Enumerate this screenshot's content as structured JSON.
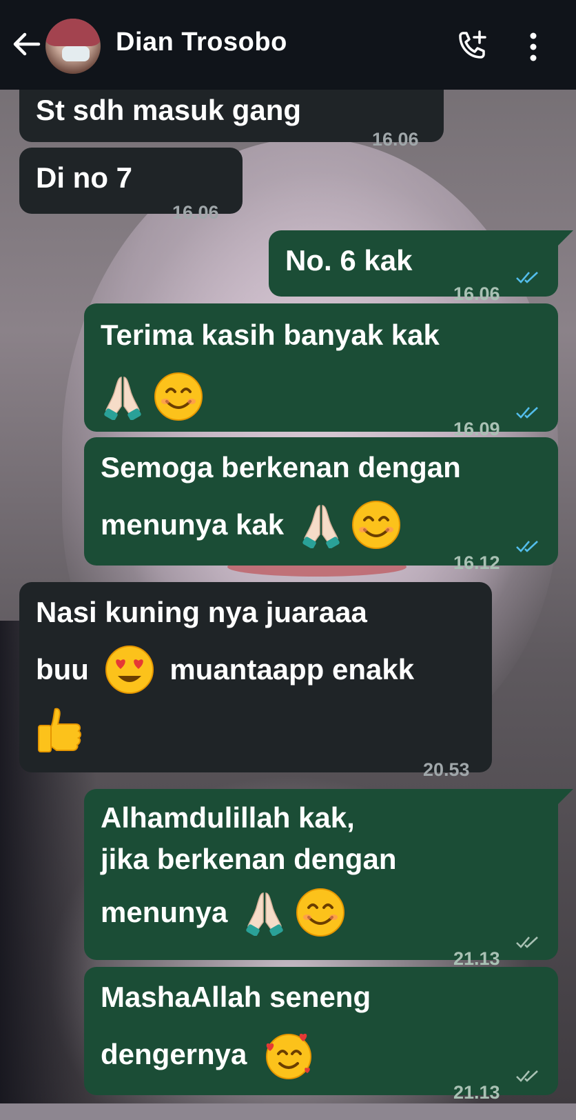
{
  "header": {
    "contact_name": "Dian Trosobo",
    "icons": [
      "back-arrow-icon",
      "avatar",
      "add-call-icon",
      "more-vert-icon"
    ]
  },
  "messages": [
    {
      "direction": "in",
      "text": "St sdh masuk gang",
      "time": "16.06"
    },
    {
      "direction": "in",
      "text": "Di no 7",
      "time": "16.06"
    },
    {
      "direction": "out",
      "text": "No. 6 kak",
      "time": "16.06",
      "status": "read"
    },
    {
      "direction": "out",
      "text": "Terima kasih banyak kak",
      "emojis": [
        "folded-hands",
        "smiling-face"
      ],
      "time": "16.09",
      "status": "read"
    },
    {
      "direction": "out",
      "text_line1": "Semoga berkenan dengan",
      "text_line2": "menunya kak",
      "emojis": [
        "folded-hands",
        "smiling-face"
      ],
      "time": "16.12",
      "status": "read"
    },
    {
      "direction": "in",
      "text_line1": "Nasi kuning nya juaraaa",
      "text_line2a": "buu",
      "text_line2b": "muantaapp enakk",
      "emojis": [
        "heart-eyes-face",
        "thumbs-up"
      ],
      "time": "20.53"
    },
    {
      "direction": "out",
      "text_line1": "Alhamdulillah kak,",
      "text_line2": "jika berkenan dengan",
      "text_line3": "menunya",
      "emojis": [
        "folded-hands",
        "smiling-face"
      ],
      "time": "21.13",
      "status": "delivered"
    },
    {
      "direction": "out",
      "text_line1": "MashaAllah seneng",
      "text_line2": "dengernya",
      "emojis": [
        "smiling-face-with-hearts"
      ],
      "time": "21.13",
      "status": "delivered"
    }
  ],
  "colors": {
    "header_bg": "#10141a",
    "incoming_bubble": "#1f2427",
    "outgoing_bubble": "#1b4d36",
    "read_ticks": "#53bdeb",
    "delivered_ticks": "#a9c1b4"
  }
}
